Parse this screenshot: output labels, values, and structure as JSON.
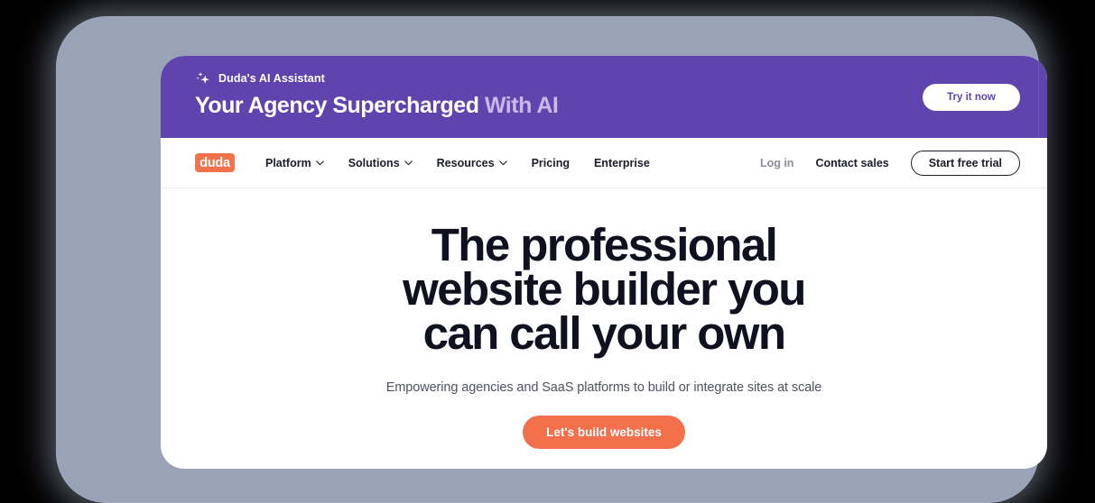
{
  "promo_banner": {
    "sparkle_icon": "sparkle-icon",
    "eyebrow": "Duda's AI Assistant",
    "headline_main": "Your Agency Supercharged",
    "headline_accent": "With AI",
    "cta_label": "Try it now",
    "background_color": "#6044ae",
    "accent_color": "#c8b9e8"
  },
  "navbar": {
    "logo_text": "duda",
    "logo_color": "#f2724b",
    "links": [
      {
        "label": "Platform",
        "has_chevron": true,
        "icon": "chevron-down-icon"
      },
      {
        "label": "Solutions",
        "has_chevron": true,
        "icon": "chevron-down-icon"
      },
      {
        "label": "Resources",
        "has_chevron": true,
        "icon": "chevron-down-icon"
      },
      {
        "label": "Pricing",
        "has_chevron": false
      },
      {
        "label": "Enterprise",
        "has_chevron": false
      }
    ],
    "login_label": "Log in",
    "contact_label": "Contact sales",
    "trial_label": "Start free trial"
  },
  "hero": {
    "title_line1": "The professional",
    "title_line2": "website builder you",
    "title_line3": "can call your own",
    "subtitle": "Empowering agencies and SaaS platforms to build or integrate sites at scale",
    "cta_label": "Let's build websites",
    "cta_color": "#f46f4b",
    "title_color": "#10111f"
  },
  "frame": {
    "frame_color": "#9aa2b7",
    "page_background": "#ffffff"
  }
}
